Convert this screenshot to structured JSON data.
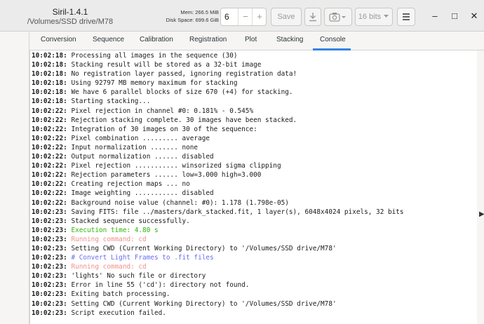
{
  "header": {
    "title": "Siril-1.4.1",
    "subtitle": "/Volumes/SSD drive/M78",
    "mem": "Mem: 266.5 MiB",
    "disk": "Disk Space: 699.6 GiB",
    "thread_count": "6",
    "spin_minus": "−",
    "spin_plus": "+",
    "save_label": "Save",
    "bits_label": "16 bits",
    "win_minimize": "–",
    "win_maximize": "□",
    "win_close": "✕"
  },
  "tabs": [
    {
      "label": "Conversion"
    },
    {
      "label": "Sequence"
    },
    {
      "label": "Calibration"
    },
    {
      "label": "Registration"
    },
    {
      "label": "Plot"
    },
    {
      "label": "Stacking"
    },
    {
      "label": "Console"
    }
  ],
  "active_tab": "Console",
  "console": {
    "lines": [
      {
        "ts": "10:02:18:",
        "msg": " Processing all images in the sequence (30)",
        "color": "default"
      },
      {
        "ts": "10:02:18:",
        "msg": " Stacking result will be stored as a 32-bit image",
        "color": "default"
      },
      {
        "ts": "10:02:18:",
        "msg": " No registration layer passed, ignoring registration data!",
        "color": "default"
      },
      {
        "ts": "10:02:18:",
        "msg": " Using 92797 MB memory maximum for stacking",
        "color": "default"
      },
      {
        "ts": "10:02:18:",
        "msg": " We have 6 parallel blocks of size 670 (+4) for stacking.",
        "color": "default"
      },
      {
        "ts": "10:02:18:",
        "msg": " Starting stacking...",
        "color": "default"
      },
      {
        "ts": "10:02:22:",
        "msg": " Pixel rejection in channel #0: 0.181% - 0.545%",
        "color": "default"
      },
      {
        "ts": "10:02:22:",
        "msg": " Rejection stacking complete. 30 images have been stacked.",
        "color": "default"
      },
      {
        "ts": "10:02:22:",
        "msg": " Integration of 30 images on 30 of the sequence:",
        "color": "default"
      },
      {
        "ts": "10:02:22:",
        "msg": " Pixel combination ......... average",
        "color": "default"
      },
      {
        "ts": "10:02:22:",
        "msg": " Input normalization ....... none",
        "color": "default"
      },
      {
        "ts": "10:02:22:",
        "msg": " Output normalization ...... disabled",
        "color": "default"
      },
      {
        "ts": "10:02:22:",
        "msg": " Pixel rejection ........... winsorized sigma clipping",
        "color": "default"
      },
      {
        "ts": "10:02:22:",
        "msg": " Rejection parameters ...... low=3.000 high=3.000",
        "color": "default"
      },
      {
        "ts": "10:02:22:",
        "msg": " Creating rejection maps ... no",
        "color": "default"
      },
      {
        "ts": "10:02:22:",
        "msg": " Image weighting ........... disabled",
        "color": "default"
      },
      {
        "ts": "10:02:22:",
        "msg": " Background noise value (channel: #0): 1.178 (1.798e-05)",
        "color": "default"
      },
      {
        "ts": "10:02:23:",
        "msg": " Saving FITS: file ../masters/dark_stacked.fit, 1 layer(s), 6048x4024 pixels, 32 bits",
        "color": "default"
      },
      {
        "ts": "10:02:23:",
        "msg": " Stacked sequence successfully.",
        "color": "default"
      },
      {
        "ts": "10:02:23:",
        "msg": " Execution time: 4.80 s",
        "color": "green"
      },
      {
        "ts": "10:02:23:",
        "msg": " Running command: cd",
        "color": "salmon"
      },
      {
        "ts": "10:02:23:",
        "msg": " Setting CWD (Current Working Directory) to '/Volumes/SSD drive/M78'",
        "color": "default"
      },
      {
        "ts": "10:02:23:",
        "msg": " # Convert Light Frames to .fit files",
        "color": "blue"
      },
      {
        "ts": "10:02:23:",
        "msg": " Running command: cd",
        "color": "salmon"
      },
      {
        "ts": "10:02:23:",
        "msg": " 'lights' No such file or directory",
        "color": "default"
      },
      {
        "ts": "10:02:23:",
        "msg": " Error in line 55 ('cd'): directory not found.",
        "color": "default"
      },
      {
        "ts": "10:02:23:",
        "msg": " Exiting batch processing.",
        "color": "default"
      },
      {
        "ts": "10:02:23:",
        "msg": " Setting CWD (Current Working Directory) to '/Volumes/SSD drive/M78'",
        "color": "default"
      },
      {
        "ts": "10:02:23:",
        "msg": " Script execution failed.",
        "color": "default"
      }
    ]
  },
  "colors": {
    "accent": "#3584e4",
    "success": "#2fb50a",
    "command": "#f0908a",
    "comment": "#6a6ef0"
  },
  "icons": [
    "download-icon",
    "camera-icon",
    "chevron-down-icon",
    "hamburger-menu-icon",
    "minimize-icon",
    "maximize-icon",
    "close-icon"
  ]
}
